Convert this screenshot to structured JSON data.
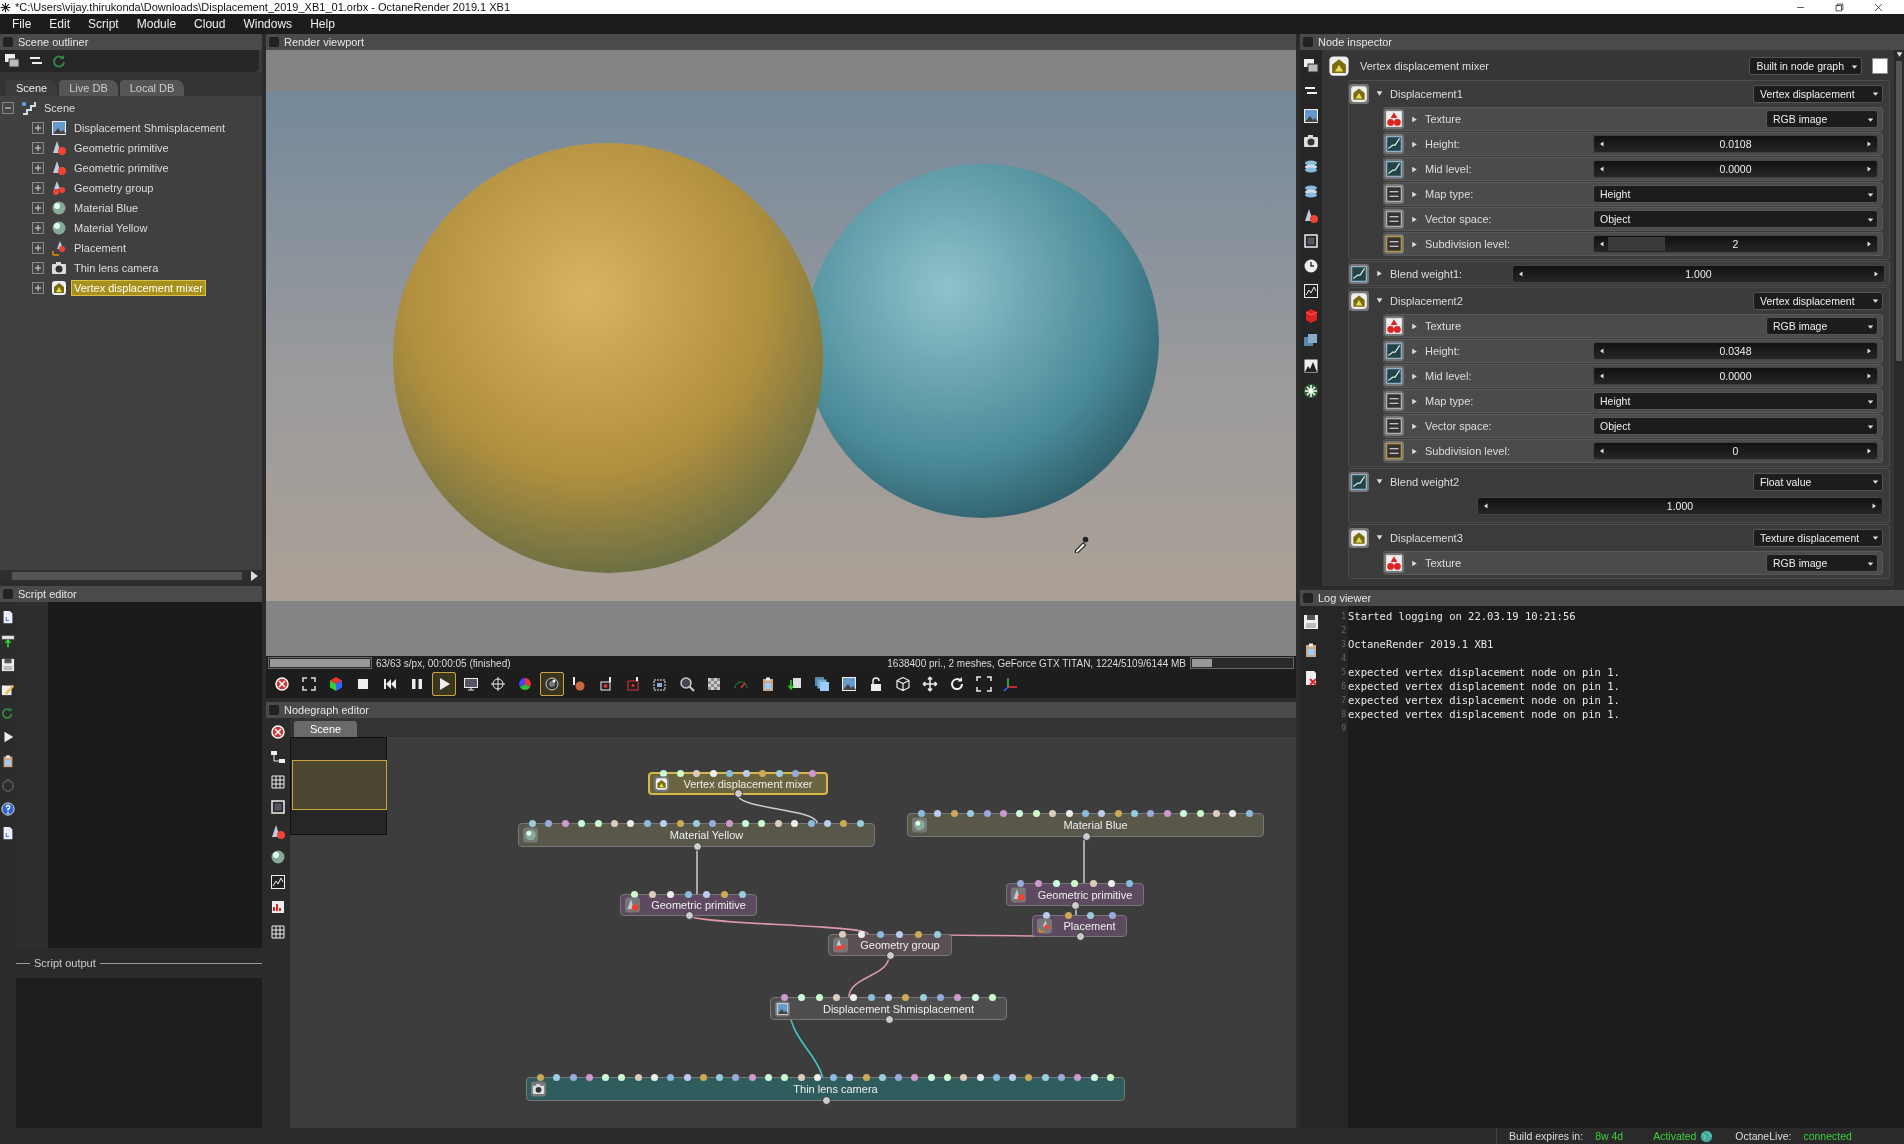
{
  "window": {
    "title": "*C:\\Users\\vijay.thirukonda\\Downloads\\Displacement_2019_XB1_01.orbx - OctaneRender 2019.1 XB1"
  },
  "menu": [
    "File",
    "Edit",
    "Script",
    "Module",
    "Cloud",
    "Windows",
    "Help"
  ],
  "outliner": {
    "title": "Scene outliner",
    "tabs": [
      {
        "label": "Scene",
        "selected": true
      },
      {
        "label": "Live DB",
        "selected": false
      },
      {
        "label": "Local DB",
        "selected": false
      }
    ],
    "tree": [
      {
        "label": "Scene",
        "kind": "scene",
        "expanded": true,
        "selected": false,
        "children": [
          {
            "label": "Displacement Shmisplacement",
            "kind": "image",
            "expanded": false,
            "selected": false
          },
          {
            "label": "Geometric primitive",
            "kind": "geometry",
            "expanded": false,
            "selected": false
          },
          {
            "label": "Geometric primitive",
            "kind": "geometry",
            "expanded": false,
            "selected": false
          },
          {
            "label": "Geometry group",
            "kind": "group",
            "expanded": false,
            "selected": false
          },
          {
            "label": "Material Blue",
            "kind": "material",
            "expanded": false,
            "selected": false
          },
          {
            "label": "Material Yellow",
            "kind": "material",
            "expanded": false,
            "selected": false
          },
          {
            "label": "Placement",
            "kind": "placement",
            "expanded": false,
            "selected": false
          },
          {
            "label": "Thin lens camera",
            "kind": "camera",
            "expanded": false,
            "selected": false
          },
          {
            "label": "Vertex displacement mixer",
            "kind": "mixer",
            "expanded": false,
            "selected": true
          }
        ]
      }
    ]
  },
  "script_editor": {
    "title": "Script editor",
    "output_label": "Script output"
  },
  "viewport": {
    "title": "Render viewport",
    "progress": {
      "level": 1,
      "text": "63/63 s/px, 00:00:05 (finished)"
    },
    "stats": "1638400 pri., 2 meshes, GeForce GTX TITAN, 1224/5109/6144 MB",
    "memory": {
      "level": 0.2
    },
    "toolbar": [
      {
        "kind": "reset",
        "on": false
      },
      {
        "kind": "fit",
        "on": false
      },
      {
        "kind": "colorcube",
        "on": false
      },
      {
        "kind": "stop",
        "on": false
      },
      {
        "kind": "rewind",
        "on": false
      },
      {
        "kind": "pause",
        "on": false
      },
      {
        "kind": "play",
        "on": true
      },
      {
        "kind": "display",
        "on": false
      },
      {
        "kind": "autofocus",
        "on": false
      },
      {
        "kind": "colorwheel",
        "on": false
      },
      {
        "kind": "lens",
        "on": true
      },
      {
        "kind": "pickmaterial",
        "on": false
      },
      {
        "kind": "pickobject",
        "on": false
      },
      {
        "kind": "pickfocus",
        "on": false
      },
      {
        "kind": "region",
        "on": false
      },
      {
        "kind": "zoom",
        "on": false
      },
      {
        "kind": "film",
        "on": false
      },
      {
        "kind": "meter",
        "on": false
      },
      {
        "kind": "clipboard",
        "on": false
      },
      {
        "kind": "export",
        "on": false
      },
      {
        "kind": "layers",
        "on": false
      },
      {
        "kind": "checker",
        "on": false
      },
      {
        "kind": "lock",
        "on": false
      },
      {
        "kind": "cube",
        "on": false
      },
      {
        "kind": "move",
        "on": false
      },
      {
        "kind": "rotate",
        "on": false
      },
      {
        "kind": "fullscreen",
        "on": false
      },
      {
        "kind": "axes",
        "on": false
      }
    ]
  },
  "nodegraph": {
    "title": "Nodegraph editor",
    "tabs": [
      {
        "label": "Scene",
        "selected": true
      }
    ],
    "nodes": [
      {
        "label": "Vertex displacement mixer",
        "kind": "mixer",
        "selected": true
      },
      {
        "label": "Material Yellow",
        "kind": "material",
        "selected": false
      },
      {
        "label": "Material Blue",
        "kind": "material",
        "selected": false
      },
      {
        "label": "Geometric primitive",
        "kind": "geometry",
        "selected": false
      },
      {
        "label": "Geometric primitive",
        "kind": "geometry",
        "selected": false
      },
      {
        "label": "Placement",
        "kind": "placement",
        "selected": false
      },
      {
        "label": "Geometry group",
        "kind": "group",
        "selected": false
      },
      {
        "label": "Displacement Shmisplacement",
        "kind": "image",
        "selected": false
      },
      {
        "label": "Thin lens camera",
        "kind": "camera",
        "selected": false
      }
    ]
  },
  "inspector": {
    "title": "Node inspector",
    "node": "Vertex displacement mixer",
    "source": "Built in node graph",
    "items": [
      {
        "kind": "group",
        "name": "Displacement1",
        "type": "Vertex displacement",
        "expanded": true,
        "params": [
          {
            "kind": "texture",
            "label": "Texture",
            "value": "RGB image",
            "expanded": false
          },
          {
            "kind": "float",
            "label": "Height:",
            "value": "0.0108",
            "expanded": false
          },
          {
            "kind": "float",
            "label": "Mid level:",
            "value": "0.0000",
            "expanded": false
          },
          {
            "kind": "enum",
            "label": "Map type:",
            "value": "Height",
            "expanded": false
          },
          {
            "kind": "enum",
            "label": "Vector space:",
            "value": "Object",
            "expanded": false
          },
          {
            "kind": "int",
            "label": "Subdivision level:",
            "value": "2",
            "level": 0.2,
            "expanded": false
          }
        ]
      },
      {
        "kind": "float",
        "label": "Blend weight1:",
        "value": "1.000",
        "expanded": false
      },
      {
        "kind": "group",
        "name": "Displacement2",
        "type": "Vertex displacement",
        "expanded": true,
        "params": [
          {
            "kind": "texture",
            "label": "Texture",
            "value": "RGB image",
            "expanded": false
          },
          {
            "kind": "float",
            "label": "Height:",
            "value": "0.0348",
            "expanded": false
          },
          {
            "kind": "float",
            "label": "Mid level:",
            "value": "0.0000",
            "expanded": false
          },
          {
            "kind": "enum",
            "label": "Map type:",
            "value": "Height",
            "expanded": false
          },
          {
            "kind": "enum",
            "label": "Vector space:",
            "value": "Object",
            "expanded": false
          },
          {
            "kind": "int",
            "label": "Subdivision level:",
            "value": "0",
            "expanded": false
          }
        ]
      },
      {
        "kind": "floatgroup",
        "name": "Blend weight2",
        "type": "Float value",
        "expanded": true,
        "params": [
          {
            "kind": "float",
            "value": "1.000"
          }
        ]
      },
      {
        "kind": "group",
        "name": "Displacement3",
        "type": "Texture displacement",
        "expanded": true,
        "params": [
          {
            "kind": "texture",
            "label": "Texture",
            "value": "RGB image",
            "expanded": false
          }
        ]
      }
    ]
  },
  "log": {
    "title": "Log viewer",
    "lines": [
      {
        "number": "1",
        "text": "Started logging on 22.03.19 10:21:56"
      },
      {
        "number": "2"
      },
      {
        "number": "3",
        "text": "OctaneRender 2019.1 XB1"
      },
      {
        "number": "4"
      },
      {
        "number": "5",
        "text": "expected vertex displacement node on pin 1."
      },
      {
        "number": "6",
        "text": "expected vertex displacement node on pin 1."
      },
      {
        "number": "7",
        "text": "expected vertex displacement node on pin 1."
      },
      {
        "number": "8",
        "text": "expected vertex displacement node on pin 1."
      },
      {
        "number": "9"
      }
    ]
  },
  "status_bar": {
    "build_label": "Build expires in:",
    "build_value": "8w 4d",
    "activation": "Activated",
    "live_label": "OctaneLive:",
    "live_value": "connected"
  }
}
